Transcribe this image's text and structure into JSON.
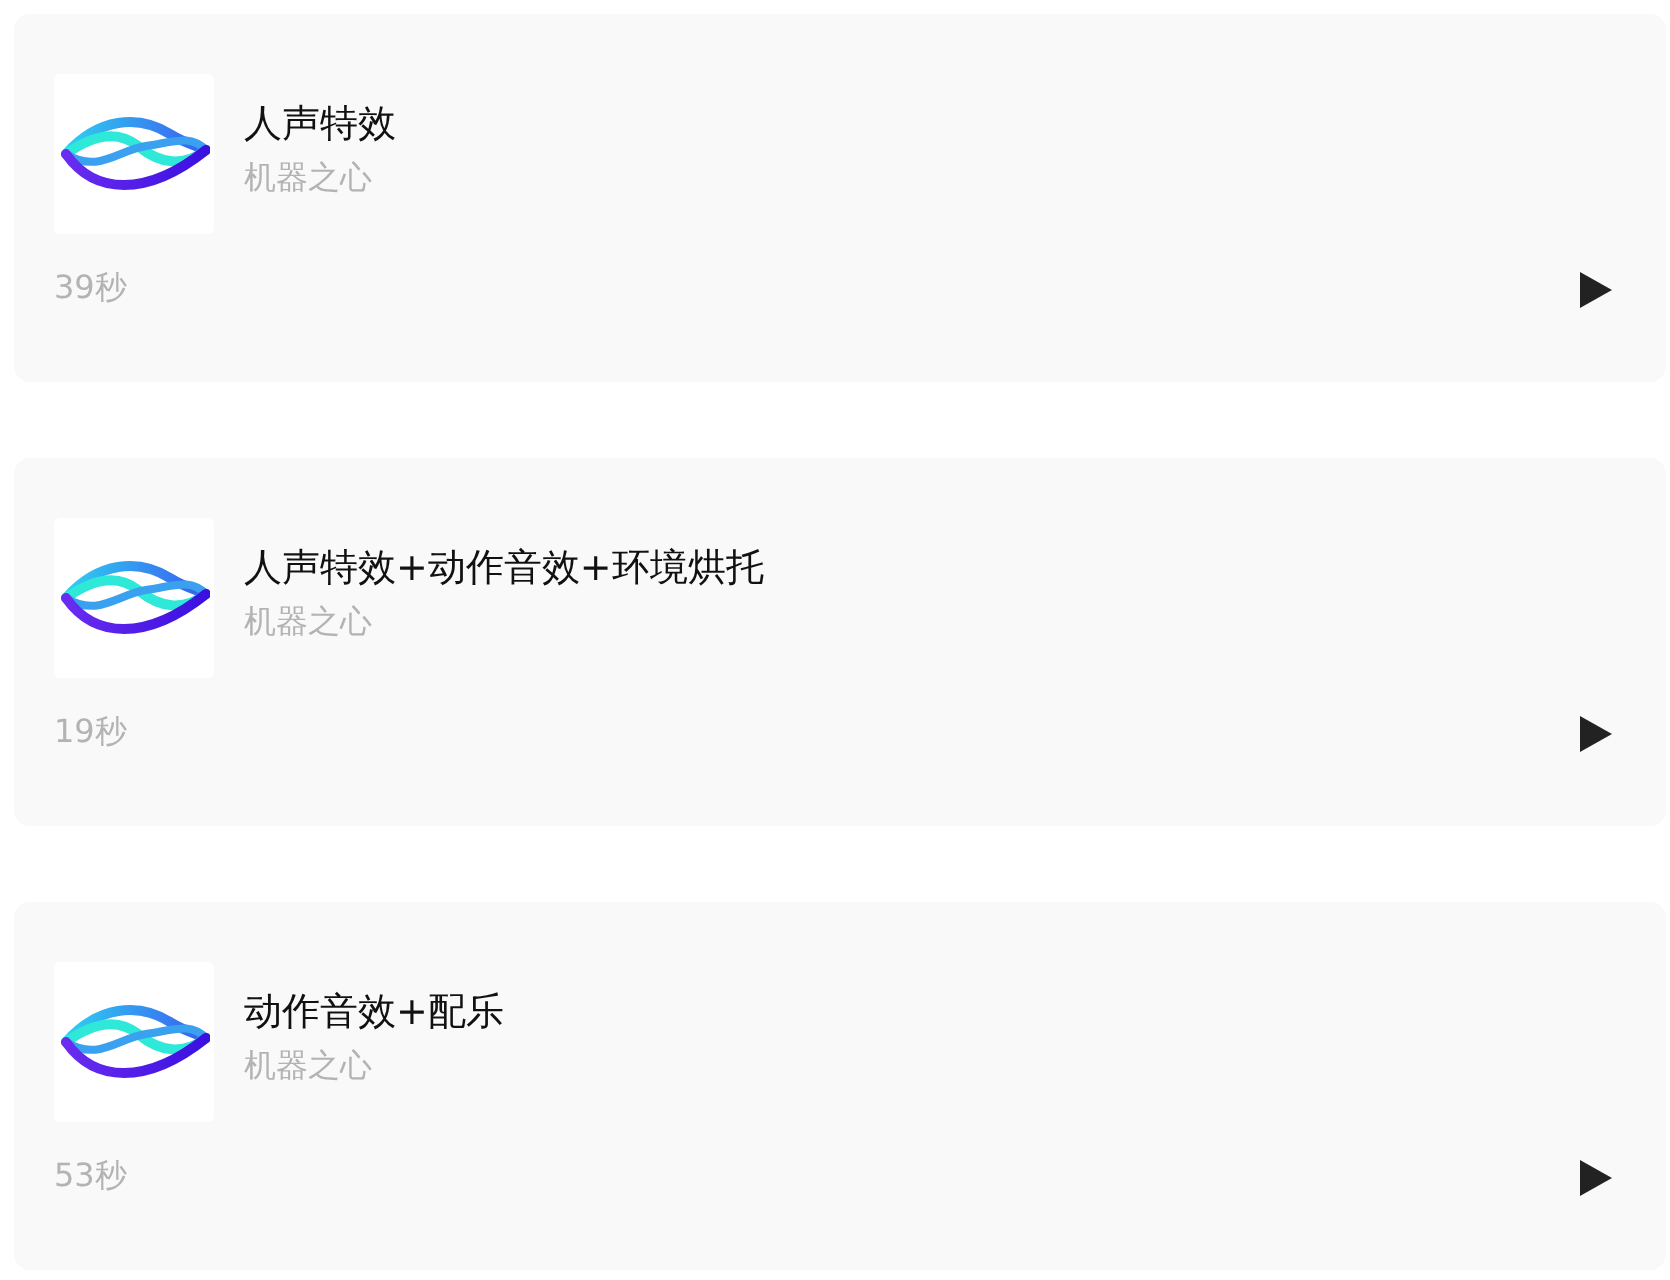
{
  "tracks": [
    {
      "title": "人声特效",
      "author": "机器之心",
      "duration": "39秒"
    },
    {
      "title": "人声特效+动作音效+环境烘托",
      "author": "机器之心",
      "duration": "19秒"
    },
    {
      "title": "动作音效+配乐",
      "author": "机器之心",
      "duration": "53秒"
    }
  ]
}
